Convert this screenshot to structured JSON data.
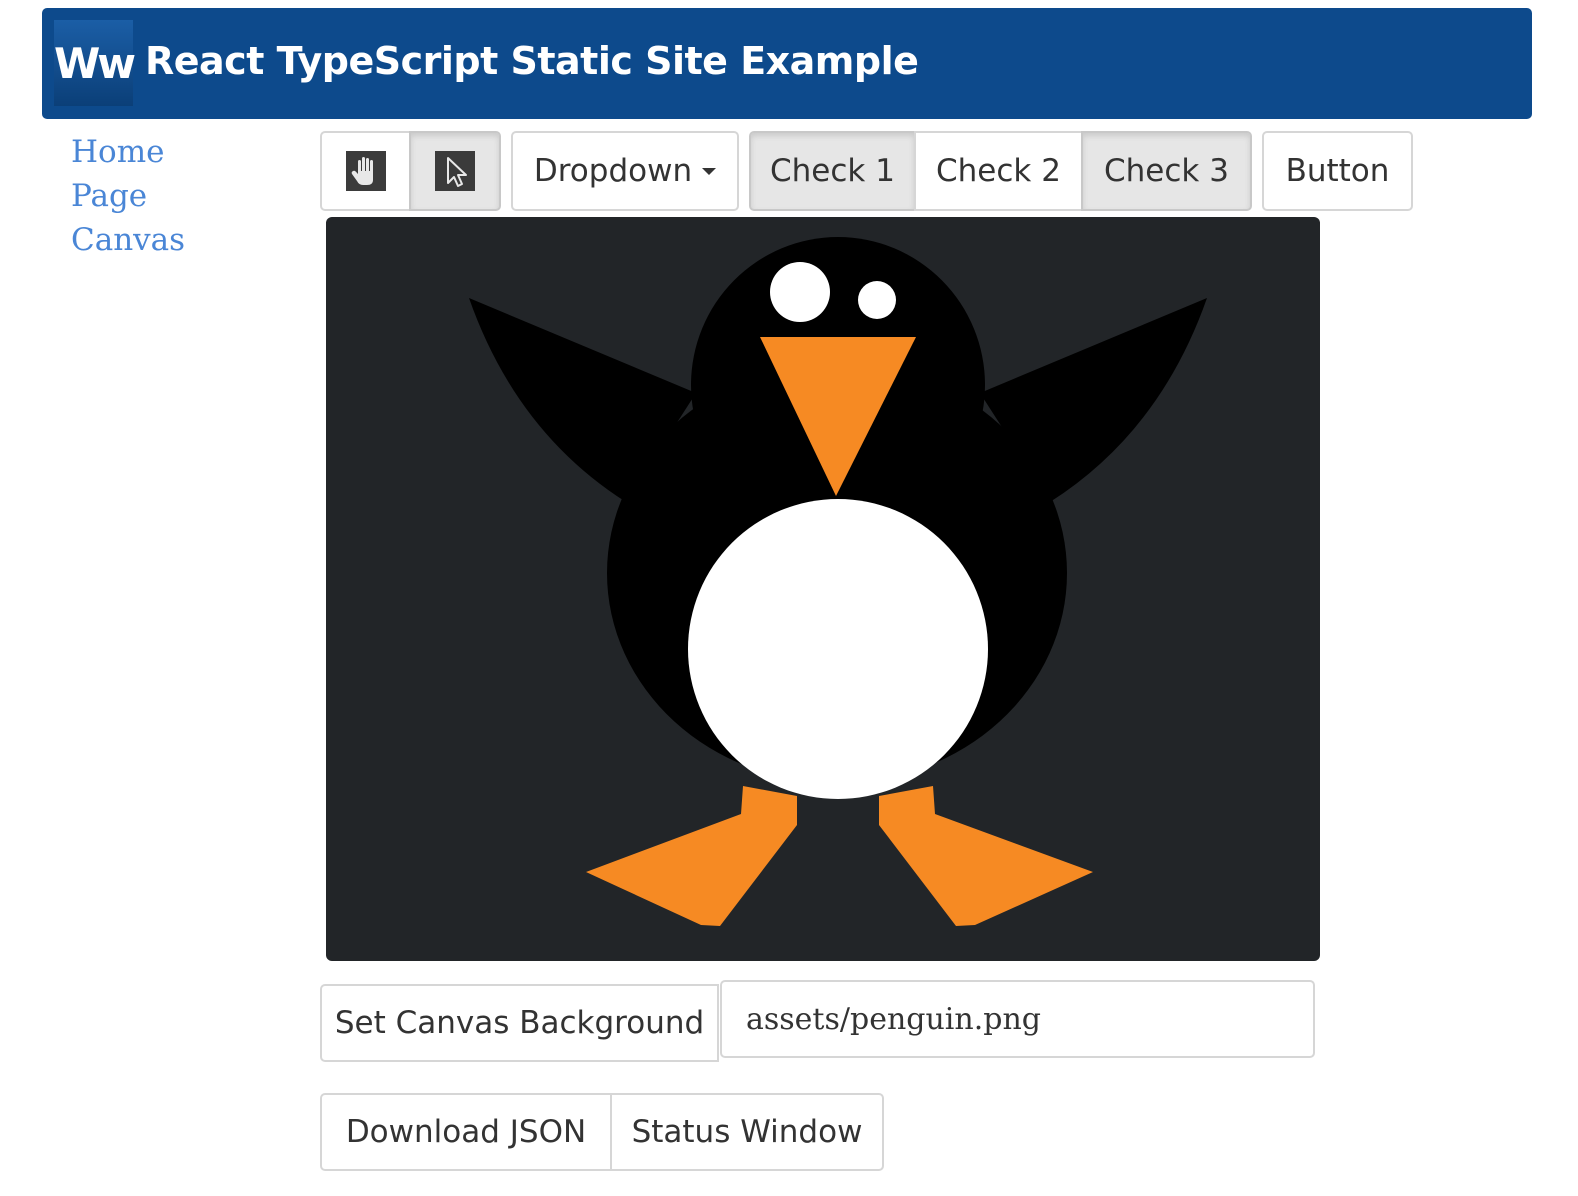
{
  "header": {
    "logo_text": "Ww",
    "title": "React TypeScript Static Site Example"
  },
  "nav": {
    "items": [
      {
        "label": "Home"
      },
      {
        "label": "Page"
      },
      {
        "label": "Canvas"
      }
    ]
  },
  "toolbar": {
    "tools": [
      {
        "icon": "hand-icon",
        "active": false
      },
      {
        "icon": "pointer-icon",
        "active": true
      }
    ],
    "dropdown_label": "Dropdown",
    "checks": [
      {
        "label": "Check 1",
        "checked": true
      },
      {
        "label": "Check 2",
        "checked": false
      },
      {
        "label": "Check 3",
        "checked": true
      }
    ],
    "button_label": "Button"
  },
  "canvas": {
    "background_image": "penguin",
    "colors": {
      "background": "#222528",
      "body": "#000000",
      "belly": "#ffffff",
      "beak": "#f68a23",
      "feet": "#f68a23"
    }
  },
  "background_form": {
    "button_label": "Set Canvas Background",
    "input_value": "assets/penguin.png"
  },
  "actions": {
    "download_label": "Download JSON",
    "status_label": "Status Window"
  }
}
